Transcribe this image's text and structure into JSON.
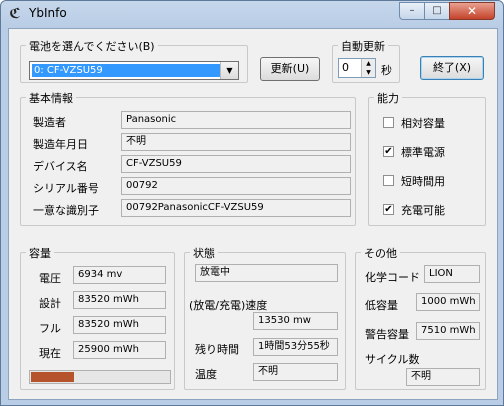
{
  "window": {
    "title": "YbInfo",
    "min_glyph": "–",
    "max_glyph": "□",
    "close_glyph": "✕"
  },
  "battery_select": {
    "label": "電池を選んでください(B)",
    "selected": "0: CF-VZSU59"
  },
  "buttons": {
    "refresh": "更新(U)",
    "exit": "終了(X)"
  },
  "auto_refresh": {
    "label": "自動更新",
    "value": "0",
    "unit": "秒"
  },
  "basic_info": {
    "title": "基本情報",
    "rows": [
      {
        "label": "製造者",
        "value": "Panasonic"
      },
      {
        "label": "製造年月日",
        "value": "不明"
      },
      {
        "label": "デバイス名",
        "value": "CF-VZSU59"
      },
      {
        "label": "シリアル番号",
        "value": "00792"
      },
      {
        "label": "一意な識別子",
        "value": "00792PanasonicCF-VZSU59"
      }
    ]
  },
  "capability": {
    "title": "能力",
    "items": [
      {
        "label": "相対容量",
        "checked": false
      },
      {
        "label": "標準電源",
        "checked": true
      },
      {
        "label": "短時間用",
        "checked": false
      },
      {
        "label": "充電可能",
        "checked": true
      }
    ]
  },
  "capacity": {
    "title": "容量",
    "rows": [
      {
        "label": "電圧",
        "value": "6934 mv"
      },
      {
        "label": "設計",
        "value": "83520 mWh"
      },
      {
        "label": "フル",
        "value": "83520 mWh"
      },
      {
        "label": "現在",
        "value": "25900 mWh"
      }
    ],
    "progress_fraction": 0.31,
    "progress_color": "#b5532c"
  },
  "status": {
    "title": "状態",
    "state_value": "放電中",
    "rate_label": "(放電/充電)速度",
    "rate_value": "13530 mw",
    "remaining_label": "残り時間",
    "remaining_value": "1時間53分55秒",
    "temp_label": "温度",
    "temp_value": "不明"
  },
  "other": {
    "title": "その他",
    "chem_label": "化学コード",
    "chem_value": "LION",
    "low_label": "低容量",
    "low_value": "1000 mWh",
    "warn_label": "警告容量",
    "warn_value": "7510 mWh",
    "cycle_label": "サイクル数",
    "cycle_value": "不明"
  }
}
